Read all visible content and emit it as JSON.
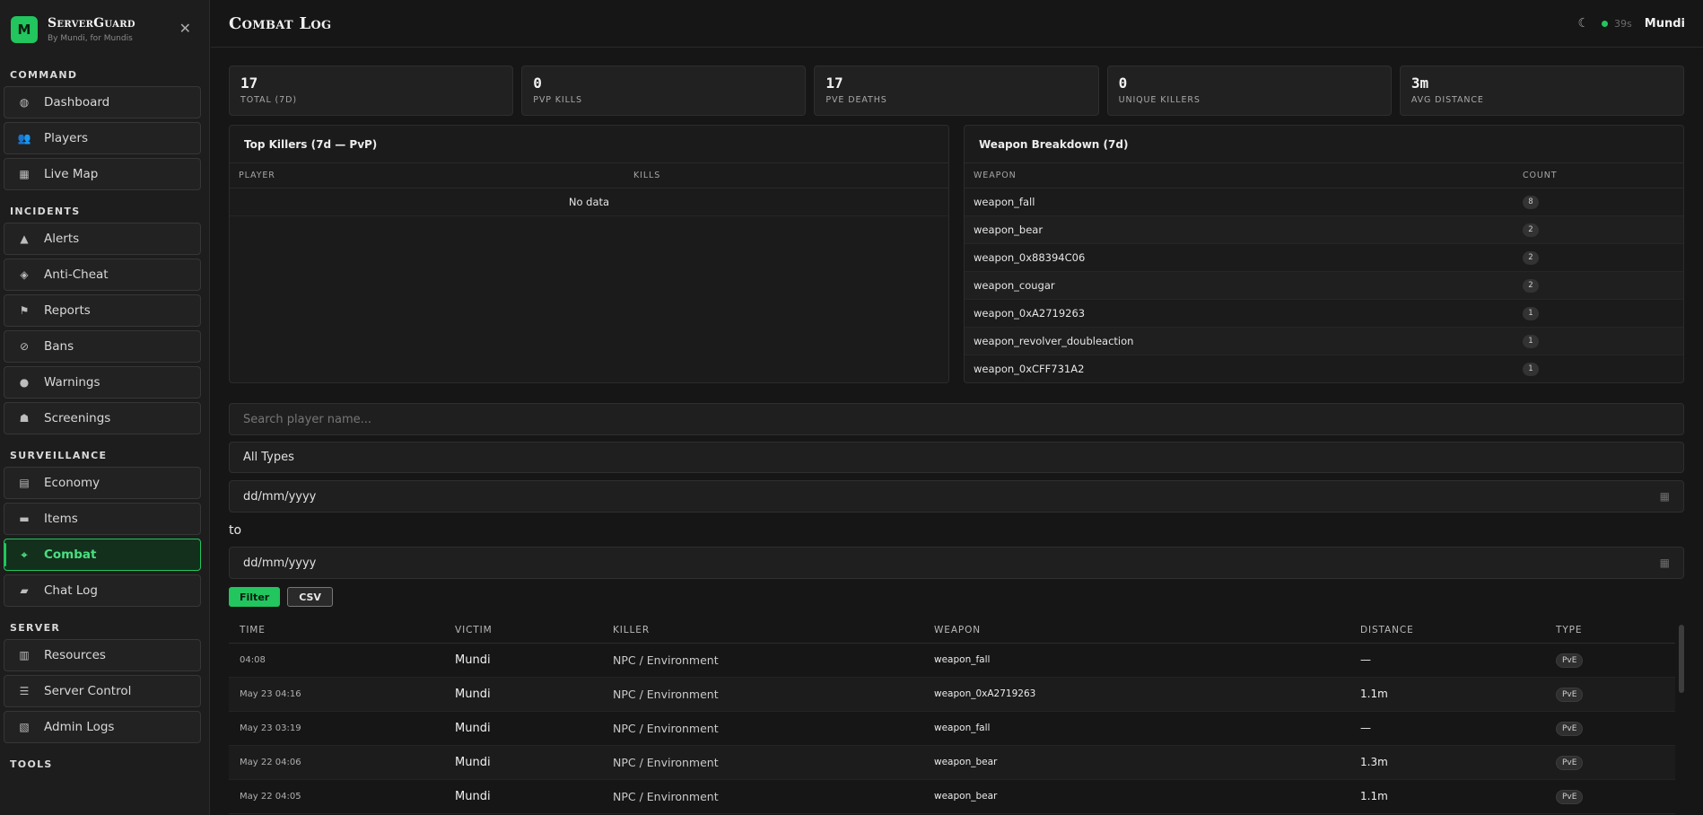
{
  "brand": {
    "logo_letter": "M",
    "title": "ServerGuard",
    "subtitle": "By Mundi, for Mundis"
  },
  "sidebar": {
    "sections": [
      {
        "label": "COMMAND",
        "items": [
          {
            "label": "Dashboard",
            "icon": "dashboard-icon",
            "glyph": "◍"
          },
          {
            "label": "Players",
            "icon": "users-icon",
            "glyph": "👥"
          },
          {
            "label": "Live Map",
            "icon": "map-icon",
            "glyph": "▦"
          }
        ]
      },
      {
        "label": "INCIDENTS",
        "items": [
          {
            "label": "Alerts",
            "icon": "warning-icon",
            "glyph": "▲"
          },
          {
            "label": "Anti-Cheat",
            "icon": "shield-icon",
            "glyph": "◈"
          },
          {
            "label": "Reports",
            "icon": "flag-icon",
            "glyph": "⚑"
          },
          {
            "label": "Bans",
            "icon": "ban-icon",
            "glyph": "⊘"
          },
          {
            "label": "Warnings",
            "icon": "exclamation-icon",
            "glyph": "●"
          },
          {
            "label": "Screenings",
            "icon": "user-check-icon",
            "glyph": "☗"
          }
        ]
      },
      {
        "label": "SURVEILLANCE",
        "items": [
          {
            "label": "Economy",
            "icon": "coins-icon",
            "glyph": "▤"
          },
          {
            "label": "Items",
            "icon": "box-icon",
            "glyph": "▬"
          },
          {
            "label": "Combat",
            "icon": "crosshair-icon",
            "glyph": "⌖",
            "active": true
          },
          {
            "label": "Chat Log",
            "icon": "chat-icon",
            "glyph": "▰"
          }
        ]
      },
      {
        "label": "SERVER",
        "items": [
          {
            "label": "Resources",
            "icon": "server-icon",
            "glyph": "▥"
          },
          {
            "label": "Server Control",
            "icon": "sliders-icon",
            "glyph": "☰"
          },
          {
            "label": "Admin Logs",
            "icon": "scroll-icon",
            "glyph": "▧"
          }
        ]
      },
      {
        "label": "TOOLS",
        "items": []
      }
    ]
  },
  "header": {
    "title": "Combat Log",
    "status_time": "39s",
    "user": "Mundi"
  },
  "stats": [
    {
      "value": "17",
      "label": "TOTAL (7D)"
    },
    {
      "value": "0",
      "label": "PVP KILLS"
    },
    {
      "value": "17",
      "label": "PVE DEATHS"
    },
    {
      "value": "0",
      "label": "UNIQUE KILLERS"
    },
    {
      "value": "3m",
      "label": "AVG DISTANCE"
    }
  ],
  "top_killers": {
    "title": "Top Killers (7d — PvP)",
    "columns": [
      "PLAYER",
      "KILLS"
    ],
    "empty_text": "No data"
  },
  "weapon_breakdown": {
    "title": "Weapon Breakdown (7d)",
    "columns": [
      "WEAPON",
      "COUNT"
    ],
    "rows": [
      {
        "weapon": "weapon_fall",
        "count": "8"
      },
      {
        "weapon": "weapon_bear",
        "count": "2"
      },
      {
        "weapon": "weapon_0x88394C06",
        "count": "2"
      },
      {
        "weapon": "weapon_cougar",
        "count": "2"
      },
      {
        "weapon": "weapon_0xA2719263",
        "count": "1"
      },
      {
        "weapon": "weapon_revolver_doubleaction",
        "count": "1"
      },
      {
        "weapon": "weapon_0xCFF731A2",
        "count": "1"
      }
    ]
  },
  "filters": {
    "search_placeholder": "Search player name...",
    "type_value": "All Types",
    "date_from_placeholder": "dd/mm/yyyy",
    "to_label": "to",
    "date_to_placeholder": "dd/mm/yyyy",
    "filter_label": "Filter",
    "csv_label": "CSV"
  },
  "log": {
    "columns": [
      "TIME",
      "VICTIM",
      "KILLER",
      "WEAPON",
      "DISTANCE",
      "TYPE"
    ],
    "rows": [
      {
        "time": "04:08",
        "victim": "Mundi",
        "killer": "NPC / Environment",
        "weapon": "weapon_fall",
        "distance": "—",
        "type": "PvE"
      },
      {
        "time": "May 23 04:16",
        "victim": "Mundi",
        "killer": "NPC / Environment",
        "weapon": "weapon_0xA2719263",
        "distance": "1.1m",
        "type": "PvE"
      },
      {
        "time": "May 23 03:19",
        "victim": "Mundi",
        "killer": "NPC / Environment",
        "weapon": "weapon_fall",
        "distance": "—",
        "type": "PvE"
      },
      {
        "time": "May 22 04:06",
        "victim": "Mundi",
        "killer": "NPC / Environment",
        "weapon": "weapon_bear",
        "distance": "1.3m",
        "type": "PvE"
      },
      {
        "time": "May 22 04:05",
        "victim": "Mundi",
        "killer": "NPC / Environment",
        "weapon": "weapon_bear",
        "distance": "1.1m",
        "type": "PvE"
      }
    ]
  },
  "colors": {
    "accent": "#22c55e",
    "background": "#161616",
    "sidebar": "#1d1d1d"
  }
}
